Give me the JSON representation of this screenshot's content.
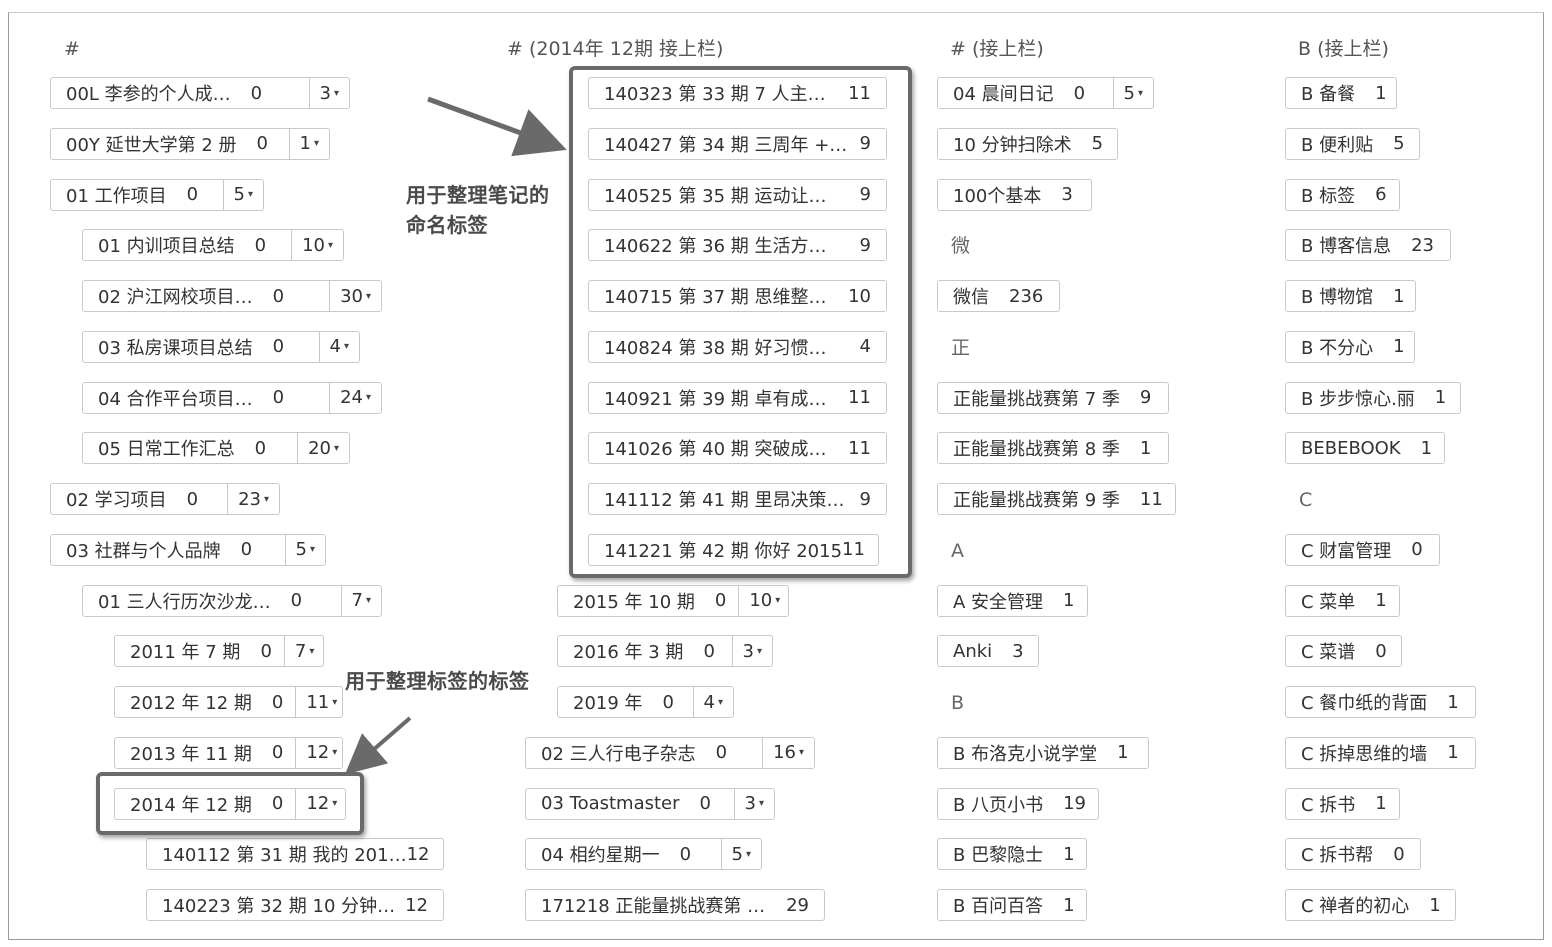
{
  "headers": [
    "#",
    "# (2014年 12期 接上栏)",
    "# (接上栏)",
    "B (接上栏)"
  ],
  "col1": [
    {
      "name": "00L 李参的个人成…",
      "count": "0",
      "dd": "3"
    },
    {
      "name": "00Y 延世大学第 2 册",
      "count": "0",
      "dd": "1"
    },
    {
      "name": "01 工作项目",
      "count": "0",
      "dd": "5"
    },
    {
      "name": "01 内训项目总结",
      "count": "0",
      "dd": "10"
    },
    {
      "name": "02 沪江网校项目…",
      "count": "0",
      "dd": "30"
    },
    {
      "name": "03 私房课项目总结",
      "count": "0",
      "dd": "4"
    },
    {
      "name": "04 合作平台项目…",
      "count": "0",
      "dd": "24"
    },
    {
      "name": "05 日常工作汇总",
      "count": "0",
      "dd": "20"
    },
    {
      "name": "02 学习项目",
      "count": "0",
      "dd": "23"
    },
    {
      "name": "03 社群与个人品牌",
      "count": "0",
      "dd": "5"
    },
    {
      "name": "01 三人行历次沙龙…",
      "count": "0",
      "dd": "7"
    },
    {
      "name": "2011 年 7 期",
      "count": "0",
      "dd": "7"
    },
    {
      "name": "2012 年 12 期",
      "count": "0",
      "dd": "11"
    },
    {
      "name": "2013 年 11 期",
      "count": "0",
      "dd": "12"
    },
    {
      "name": "2014 年 12 期",
      "count": "0",
      "dd": "12"
    },
    {
      "name": "140112 第 31 期 我的 201…",
      "count": "12"
    },
    {
      "name": "140223 第 32 期 10 分钟…",
      "count": "12"
    }
  ],
  "col2": [
    {
      "name": "140323 第 33 期 7 人主…",
      "count": "11"
    },
    {
      "name": "140427 第 34 期 三周年 +…",
      "count": "9"
    },
    {
      "name": "140525 第 35 期 运动让…",
      "count": "9"
    },
    {
      "name": "140622 第 36 期 生活方…",
      "count": "9"
    },
    {
      "name": "140715 第 37 期 思维整…",
      "count": "10"
    },
    {
      "name": "140824 第 38 期 好习惯…",
      "count": "4"
    },
    {
      "name": "140921 第 39 期 卓有成…",
      "count": "11"
    },
    {
      "name": "141026 第 40 期 突破成…",
      "count": "11"
    },
    {
      "name": "141112 第 41 期 里昂决策…",
      "count": "9"
    },
    {
      "name": "141221 第 42 期 你好 2015",
      "count": "11"
    },
    {
      "name": "2015 年 10 期",
      "count": "0",
      "dd": "10"
    },
    {
      "name": "2016 年 3 期",
      "count": "0",
      "dd": "3"
    },
    {
      "name": "2019 年",
      "count": "0",
      "dd": "4"
    },
    {
      "name": "02 三人行电子杂志",
      "count": "0",
      "dd": "16"
    },
    {
      "name": "03 Toastmaster",
      "count": "0",
      "dd": "3"
    },
    {
      "name": "04 相约星期一",
      "count": "0",
      "dd": "5"
    },
    {
      "name": "171218 正能量挑战赛第 …",
      "count": "29"
    }
  ],
  "col3": [
    {
      "name": "04 晨间日记",
      "count": "0",
      "dd": "5"
    },
    {
      "name": "10 分钟扫除术",
      "count": "5"
    },
    {
      "name": "100个基本",
      "count": "3"
    },
    {
      "section": "微"
    },
    {
      "name": "微信",
      "count": "236"
    },
    {
      "section": "正"
    },
    {
      "name": "正能量挑战赛第 7 季",
      "count": "9"
    },
    {
      "name": "正能量挑战赛第 8 季",
      "count": "1"
    },
    {
      "name": "正能量挑战赛第 9 季",
      "count": "11"
    },
    {
      "section": "A"
    },
    {
      "name": "A 安全管理",
      "count": "1"
    },
    {
      "name": "Anki",
      "count": "3"
    },
    {
      "section": "B"
    },
    {
      "name": "B 布洛克小说学堂",
      "count": "1"
    },
    {
      "name": "B 八页小书",
      "count": "19"
    },
    {
      "name": "B 巴黎隐士",
      "count": "1"
    },
    {
      "name": "B 百问百答",
      "count": "1"
    }
  ],
  "col4": [
    {
      "name": "B 备餐",
      "count": "1"
    },
    {
      "name": "B 便利贴",
      "count": "5"
    },
    {
      "name": "B 标签",
      "count": "6"
    },
    {
      "name": "B 博客信息",
      "count": "23"
    },
    {
      "name": "B 博物馆",
      "count": "1"
    },
    {
      "name": "B 不分心",
      "count": "1"
    },
    {
      "name": "B 步步惊心.丽",
      "count": "1"
    },
    {
      "name": "BEBEBOOK",
      "count": "1"
    },
    {
      "section": "C"
    },
    {
      "name": "C 财富管理",
      "count": "0"
    },
    {
      "name": "C 菜单",
      "count": "1"
    },
    {
      "name": "C 菜谱",
      "count": "0"
    },
    {
      "name": "C 餐巾纸的背面",
      "count": "1"
    },
    {
      "name": "C 拆掉思维的墙",
      "count": "1"
    },
    {
      "name": "C 拆书",
      "count": "1"
    },
    {
      "name": "C 拆书帮",
      "count": "0"
    },
    {
      "name": "C 禅者的初心",
      "count": "1"
    }
  ],
  "annotations": {
    "naming_tags": [
      "用于整理笔记的",
      "命名标签"
    ],
    "tag_tags": "用于整理标签的标签"
  },
  "colors": {
    "border": "#c9c9c9",
    "highlight": "#6a6a6a",
    "text": "#333333"
  }
}
